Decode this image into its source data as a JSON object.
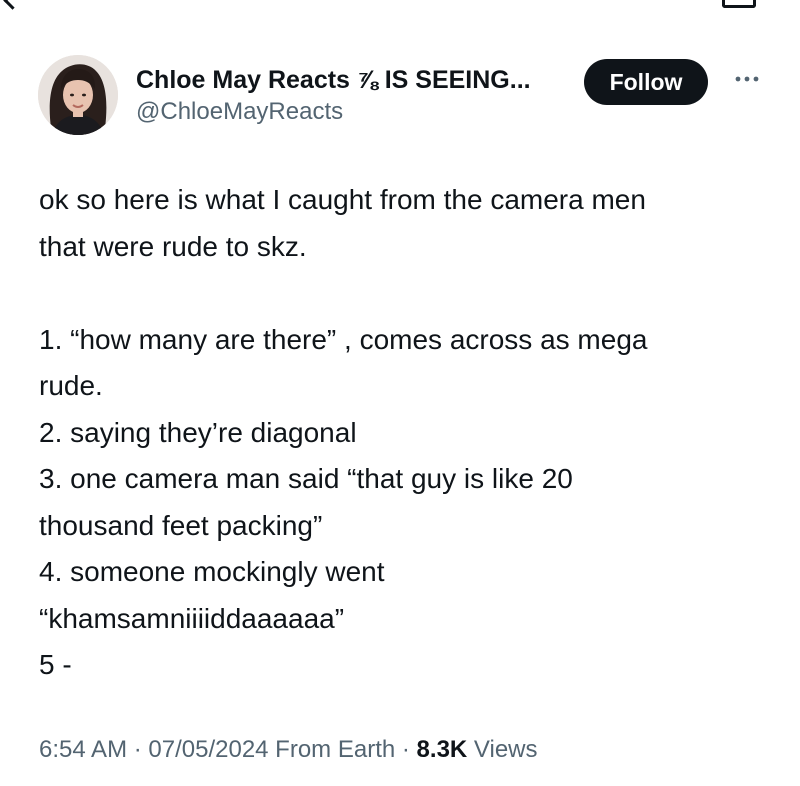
{
  "author": {
    "display_name": "Chloe May Reacts ⅞ IS SEEING...",
    "handle": "@ChloeMayReacts",
    "avatar_icon": "profile-photo"
  },
  "actions": {
    "follow_label": "Follow",
    "more_icon": "more-horizontal-icon"
  },
  "tweet": {
    "lines": [
      "ok so here is what I caught from the camera men",
      "that were rude to skz.",
      "",
      "1. “how many are there” , comes across as mega",
      "rude.",
      "2. saying they’re diagonal",
      "3. one camera man said “that guy is like 20",
      "thousand feet packing”",
      "4. someone mockingly went",
      "“khamsamniiiiddaaaaaa”",
      "5 -"
    ]
  },
  "meta": {
    "time": "6:54 AM",
    "sep1": " · ",
    "date": "07/05/2024",
    "source": " From Earth",
    "sep2": " · ",
    "views_count": "8.3K",
    "views_label": " Views"
  },
  "colors": {
    "text": "#0f1419",
    "secondary": "#536471",
    "follow_bg": "#0f1419",
    "follow_text": "#ffffff"
  }
}
